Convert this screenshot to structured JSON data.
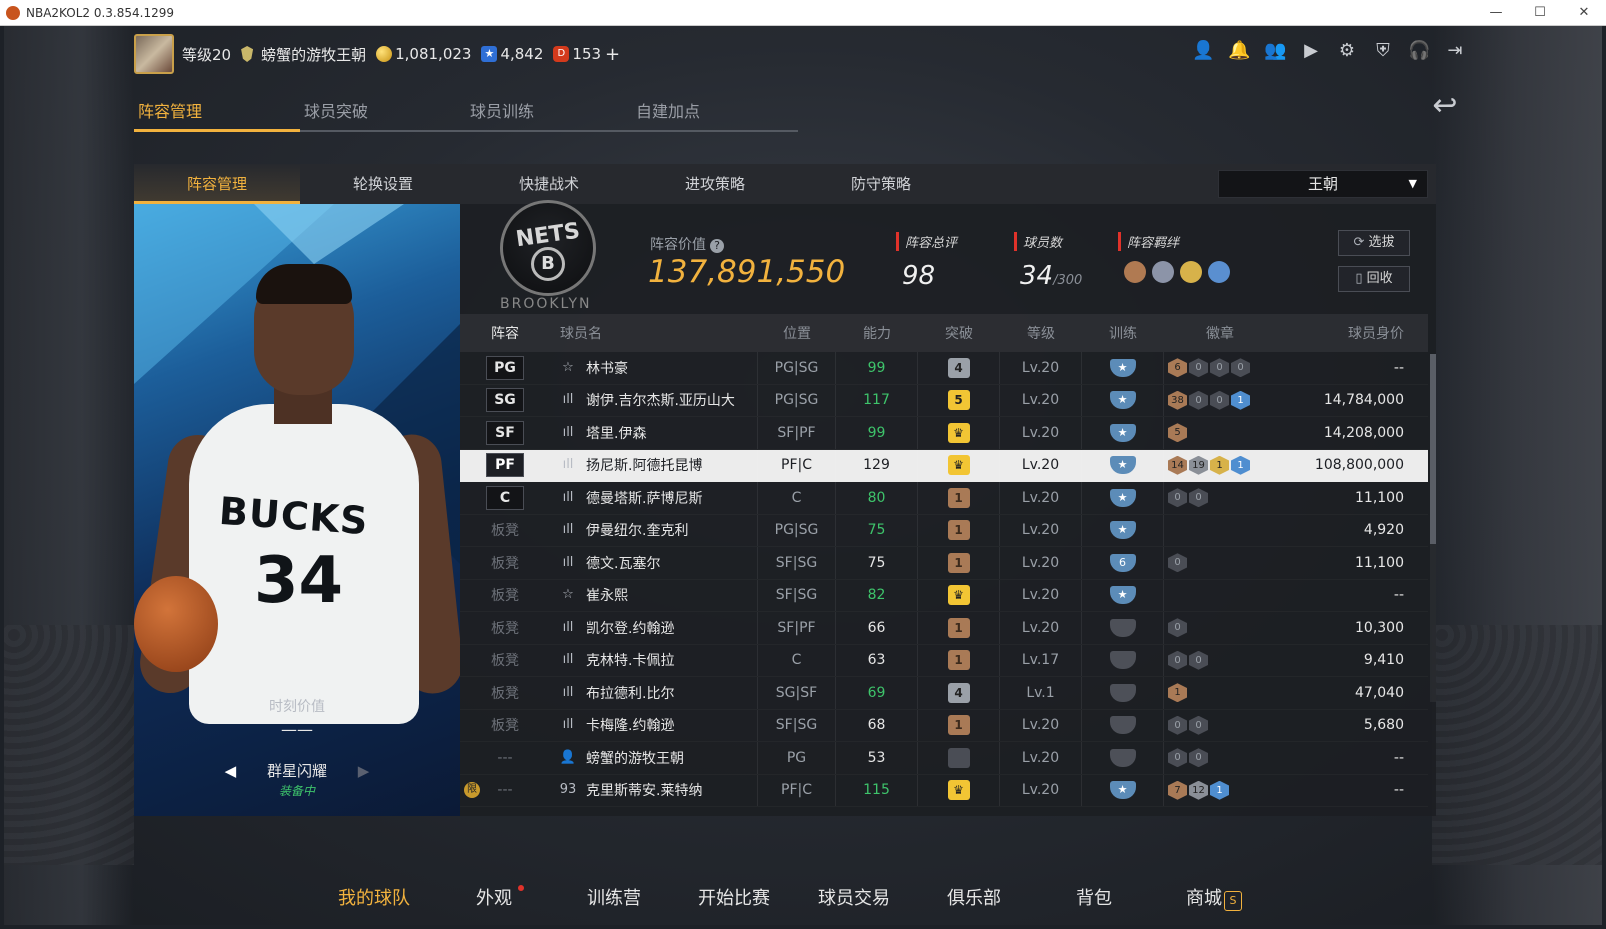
{
  "window": {
    "title": "NBA2KOL2 0.3.854.1299",
    "min": "—",
    "max": "☐",
    "close": "✕"
  },
  "header": {
    "level": "等级20",
    "dynasty_name": "螃蟹的游牧王朝",
    "coins": "1,081,023",
    "stars": "4,842",
    "tickets": "153",
    "plus": "+",
    "icons": [
      "user-icon",
      "bell-icon",
      "friends-icon",
      "video-icon",
      "gear-icon",
      "shield-icon",
      "support-icon",
      "exit-icon"
    ]
  },
  "tabs": [
    {
      "label": "阵容管理",
      "active": true
    },
    {
      "label": "球员突破"
    },
    {
      "label": "球员训练"
    },
    {
      "label": "自建加点"
    }
  ],
  "subtabs": [
    {
      "label": "阵容管理",
      "active": true
    },
    {
      "label": "轮换设置"
    },
    {
      "label": "快捷战术"
    },
    {
      "label": "进攻策略"
    },
    {
      "label": "防守策略"
    }
  ],
  "team_select": {
    "value": "王朝"
  },
  "card": {
    "moment_label": "时刻价值",
    "moment_value": "——",
    "series": "群星闪耀",
    "equipped": "装备中",
    "jersey_text": "BUCKS",
    "jersey_number": "34"
  },
  "summary": {
    "logo_text": "NETS",
    "logo_letter": "B",
    "logo_caption": "BROOKLYN",
    "value_label": "阵容价值",
    "value": "137,891,550",
    "rating_label": "阵容总评",
    "rating": "98",
    "count_label": "球员数",
    "count": "34",
    "count_max": "/300",
    "bond_label": "阵容羁绊",
    "pick_btn": "选拔",
    "recycle_btn": "回收"
  },
  "table": {
    "headers": [
      "阵容",
      "球员名",
      "位置",
      "能力",
      "突破",
      "等级",
      "训练",
      "徽章",
      "球员身价"
    ],
    "rows": [
      {
        "lineup": "PG",
        "starter": true,
        "type": "☆",
        "name": "林书豪",
        "pos": "PG|SG",
        "ovr": "99",
        "ovr_green": true,
        "brk": "4",
        "brk_style": "gray",
        "lvl": "Lv.20",
        "trn": "★",
        "badges": [
          [
            "6",
            "bronze"
          ],
          [
            "0",
            "dark"
          ],
          [
            "0",
            "dark"
          ],
          [
            "0",
            "dark"
          ]
        ],
        "price": "--"
      },
      {
        "lineup": "SG",
        "starter": true,
        "type": "ıll",
        "name": "谢伊.吉尔杰斯.亚历山大",
        "pos": "PG|SG",
        "ovr": "117",
        "ovr_green": true,
        "brk": "5",
        "brk_style": "gold",
        "lvl": "Lv.20",
        "trn": "★",
        "badges": [
          [
            "38",
            "bronze"
          ],
          [
            "0",
            "dark"
          ],
          [
            "0",
            "dark"
          ],
          [
            "1",
            "blue"
          ]
        ],
        "price": "14,784,000"
      },
      {
        "lineup": "SF",
        "starter": true,
        "type": "ıll",
        "name": "塔里.伊森",
        "pos": "SF|PF",
        "ovr": "99",
        "ovr_green": true,
        "brk": "♛",
        "brk_style": "gold",
        "lvl": "Lv.20",
        "trn": "★",
        "badges": [
          [
            "5",
            "bronze"
          ]
        ],
        "price": "14,208,000"
      },
      {
        "lineup": "PF",
        "starter": true,
        "selected": true,
        "type": "ıll",
        "name": "扬尼斯.阿德托昆博",
        "pos": "PF|C",
        "ovr": "129",
        "ovr_green": false,
        "brk": "♛",
        "brk_style": "gold",
        "lvl": "Lv.20",
        "trn": "★",
        "badges": [
          [
            "14",
            "bronze"
          ],
          [
            "19",
            "silver"
          ],
          [
            "1",
            "gold"
          ],
          [
            "1",
            "blue"
          ]
        ],
        "price": "108,800,000"
      },
      {
        "lineup": "C",
        "starter": true,
        "type": "ıll",
        "name": "德曼塔斯.萨博尼斯",
        "pos": "C",
        "ovr": "80",
        "ovr_green": true,
        "brk": "1",
        "brk_style": "bronze",
        "lvl": "Lv.20",
        "trn": "★",
        "badges": [
          [
            "0",
            "dark"
          ],
          [
            "0",
            "dark"
          ]
        ],
        "price": "11,100"
      },
      {
        "lineup": "板凳",
        "type": "ıll",
        "name": "伊曼纽尔.奎克利",
        "pos": "PG|SG",
        "ovr": "75",
        "ovr_green": true,
        "brk": "1",
        "brk_style": "bronze",
        "lvl": "Lv.20",
        "trn": "★",
        "badges": [],
        "price": "4,920"
      },
      {
        "lineup": "板凳",
        "type": "ıll",
        "name": "德文.瓦塞尔",
        "pos": "SF|SG",
        "ovr": "75",
        "ovr_green": false,
        "brk": "1",
        "brk_style": "bronze",
        "lvl": "Lv.20",
        "trn": "6",
        "badges": [
          [
            "0",
            "dark"
          ]
        ],
        "price": "11,100"
      },
      {
        "lineup": "板凳",
        "type": "☆",
        "name": "崔永熙",
        "pos": "SF|SG",
        "ovr": "82",
        "ovr_green": true,
        "brk": "♛",
        "brk_style": "gold",
        "lvl": "Lv.20",
        "trn": "★",
        "badges": [],
        "price": "--"
      },
      {
        "lineup": "板凳",
        "type": "ıll",
        "name": "凯尔登.约翰逊",
        "pos": "SF|PF",
        "ovr": "66",
        "ovr_green": false,
        "brk": "1",
        "brk_style": "bronze",
        "lvl": "Lv.20",
        "trn": "",
        "trn_dim": true,
        "badges": [
          [
            "0",
            "dark"
          ]
        ],
        "price": "10,300"
      },
      {
        "lineup": "板凳",
        "type": "ıll",
        "name": "克林特.卡佩拉",
        "pos": "C",
        "ovr": "63",
        "ovr_green": false,
        "brk": "1",
        "brk_style": "bronze",
        "lvl": "Lv.17",
        "trn": "",
        "trn_dim": true,
        "badges": [
          [
            "0",
            "dark"
          ],
          [
            "0",
            "dark"
          ]
        ],
        "price": "9,410"
      },
      {
        "lineup": "板凳",
        "type": "ıll",
        "name": "布拉德利.比尔",
        "pos": "SG|SF",
        "ovr": "69",
        "ovr_green": true,
        "brk": "4",
        "brk_style": "gray",
        "lvl": "Lv.1",
        "trn": "",
        "trn_dim": true,
        "badges": [
          [
            "1",
            "bronze"
          ]
        ],
        "price": "47,040"
      },
      {
        "lineup": "板凳",
        "type": "ıll",
        "name": "卡梅隆.约翰逊",
        "pos": "SF|SG",
        "ovr": "68",
        "ovr_green": false,
        "brk": "1",
        "brk_style": "bronze",
        "lvl": "Lv.20",
        "trn": "",
        "trn_dim": true,
        "badges": [
          [
            "0",
            "dark"
          ],
          [
            "0",
            "dark"
          ]
        ],
        "price": "5,680"
      },
      {
        "lineup": "---",
        "type": "👤",
        "name": "螃蟹的游牧王朝",
        "pos": "PG",
        "ovr": "53",
        "ovr_green": false,
        "brk": "",
        "brk_style": "dark",
        "lvl": "Lv.20",
        "trn": "",
        "trn_dim": true,
        "badges": [
          [
            "0",
            "dark"
          ],
          [
            "0",
            "dark"
          ]
        ],
        "price": "--"
      },
      {
        "lineup": "---",
        "limited": "限",
        "type": "93",
        "name": "克里斯蒂安.莱特纳",
        "pos": "PF|C",
        "ovr": "115",
        "ovr_green": true,
        "brk": "♛",
        "brk_style": "gold",
        "lvl": "Lv.20",
        "trn": "★",
        "badges": [
          [
            "7",
            "bronze"
          ],
          [
            "12",
            "silver"
          ],
          [
            "1",
            "blue"
          ]
        ],
        "price": "--"
      }
    ]
  },
  "bottom_nav": [
    {
      "label": "我的球队",
      "active": true
    },
    {
      "label": "外观",
      "dot": true
    },
    {
      "label": "训练营"
    },
    {
      "label": "开始比赛"
    },
    {
      "label": "球员交易"
    },
    {
      "label": "俱乐部"
    },
    {
      "label": "背包"
    },
    {
      "label": "商城",
      "tag": "S"
    }
  ]
}
